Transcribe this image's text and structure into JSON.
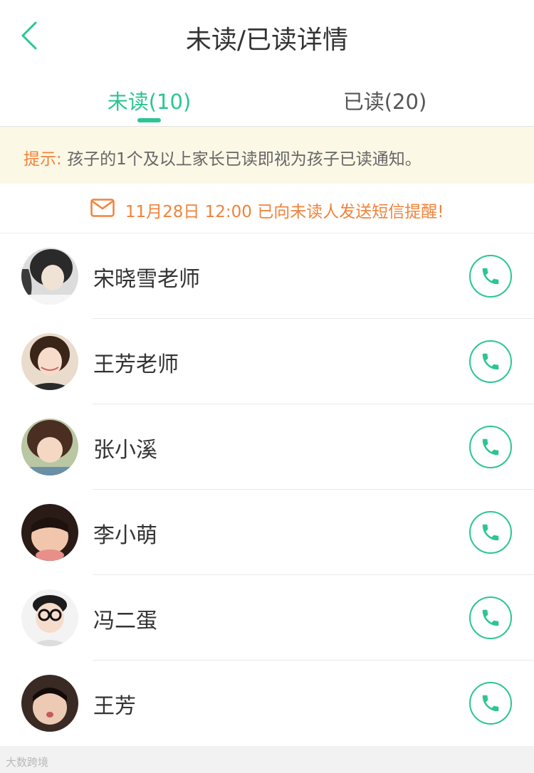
{
  "nav": {
    "title": "未读/已读详情"
  },
  "tabs": {
    "unread": "未读(10)",
    "read": "已读(20)"
  },
  "tip": {
    "label": "提示:",
    "text": "孩子的1个及以上家长已读即视为孩子已读通知。"
  },
  "sms": {
    "text": "11月28日 12:00 已向未读人发送短信提醒!"
  },
  "contacts": [
    {
      "name": "宋晓雪老师"
    },
    {
      "name": "王芳老师"
    },
    {
      "name": "张小溪"
    },
    {
      "name": "李小萌"
    },
    {
      "name": "冯二蛋"
    },
    {
      "name": "王芳"
    }
  ],
  "watermark": "大数跨境",
  "colors": {
    "accent": "#2cc593",
    "tip_orange": "#f0833a",
    "tip_bg": "#fcf8e6"
  },
  "icons": {
    "back": "chevron-left-icon",
    "mail": "envelope-icon",
    "call": "phone-icon"
  }
}
